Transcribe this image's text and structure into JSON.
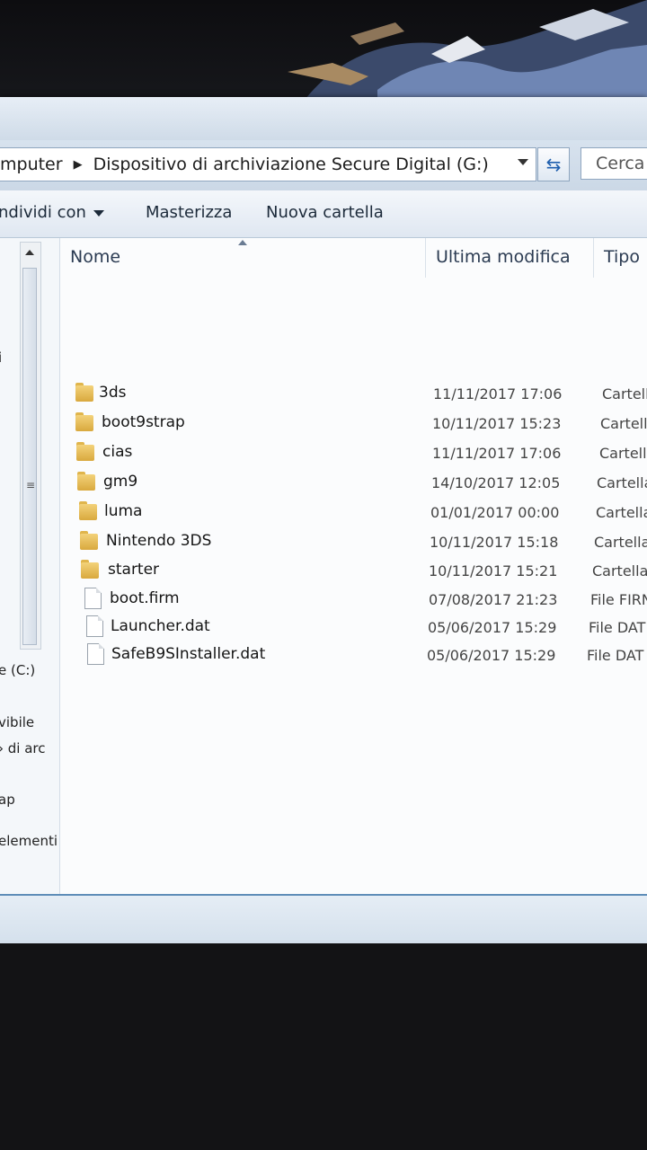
{
  "address_bar": {
    "breadcrumb": [
      "mputer",
      "Dispositivo di archiviazione Secure Digital (G:)"
    ],
    "search_placeholder": "Cerca D"
  },
  "toolbar": {
    "share_label": "ndividi con",
    "burn_label": "Masterizza",
    "new_folder_label": "Nuova cartella"
  },
  "nav_pane": {
    "fragments": [
      "i",
      "e (C:)",
      "vibile",
      "› di arc",
      "ap",
      "elementi"
    ]
  },
  "columns": {
    "name": "Nome",
    "modified": "Ultima modifica",
    "type": "Tipo"
  },
  "files": [
    {
      "name": "3ds",
      "modified": "11/11/2017 17:06",
      "type": "Cartell",
      "icon": "folder-icon"
    },
    {
      "name": "boot9strap",
      "modified": "10/11/2017 15:23",
      "type": "Cartell",
      "icon": "folder-icon"
    },
    {
      "name": "cias",
      "modified": "11/11/2017 17:06",
      "type": "Cartell",
      "icon": "folder-icon"
    },
    {
      "name": "gm9",
      "modified": "14/10/2017 12:05",
      "type": "Cartella",
      "icon": "folder-icon"
    },
    {
      "name": "luma",
      "modified": "01/01/2017 00:00",
      "type": "Cartella",
      "icon": "folder-icon"
    },
    {
      "name": "Nintendo 3DS",
      "modified": "10/11/2017 15:18",
      "type": "Cartella",
      "icon": "folder-icon"
    },
    {
      "name": "starter",
      "modified": "10/11/2017 15:21",
      "type": "Cartella",
      "icon": "folder-icon"
    },
    {
      "name": "boot.firm",
      "modified": "07/08/2017 21:23",
      "type": "File FIRN",
      "icon": "file-icon"
    },
    {
      "name": "Launcher.dat",
      "modified": "05/06/2017 15:29",
      "type": "File DAT",
      "icon": "file-icon"
    },
    {
      "name": "SafeB9SInstaller.dat",
      "modified": "05/06/2017 15:29",
      "type": "File DAT",
      "icon": "file-icon"
    }
  ],
  "colors": {
    "window_chrome": "#dfe7ee",
    "list_background": "#fbfcfd",
    "status_border": "#5e8db8",
    "folder_yellow": "#e0b54c"
  }
}
